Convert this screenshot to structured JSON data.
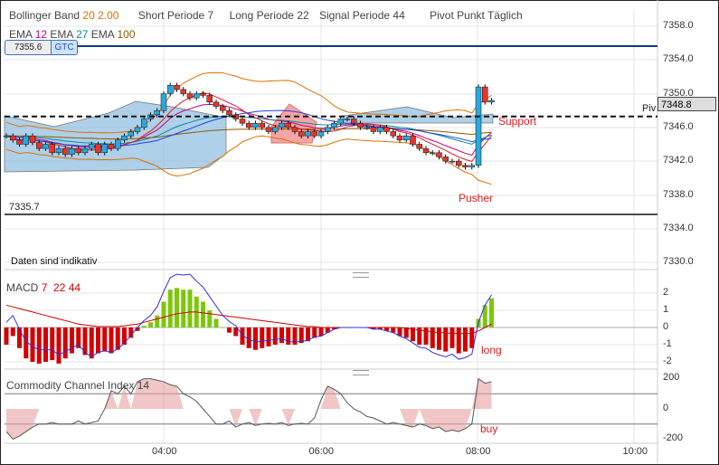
{
  "header": {
    "bollinger_label": "Bollinger Band",
    "bollinger_period": "20",
    "bollinger_dev": "2.00",
    "short_label": "Short Periode",
    "short_value": "7",
    "long_label": "Long Periode",
    "long_value": "22",
    "signal_label": "Signal Periode",
    "signal_value": "44",
    "pivot_label": "Pivot Punkt",
    "pivot_value": "Täglich",
    "ema1_label": "EMA",
    "ema1_value": "12",
    "ema2_label": "EMA",
    "ema2_value": "27",
    "ema3_label": "EMA",
    "ema3_value": "100"
  },
  "order": {
    "price": "7355.6",
    "type": "GTC"
  },
  "low_line_label": "7335.7",
  "pivot_short": "Piv",
  "current_price": "7348.8",
  "annotations": {
    "support": "Support",
    "pusher": "Pusher",
    "long": "long",
    "buy": "buy"
  },
  "disclaimer": "Daten sind indikativ",
  "macd": {
    "label": "MACD",
    "p1": "7",
    "p2": "22",
    "p3": "44",
    "axis": [
      "2",
      "1",
      "0",
      "-1",
      "-2"
    ]
  },
  "cci": {
    "label": "Commodity Channel Index",
    "period": "14",
    "axis": [
      "200",
      "0",
      "-200"
    ]
  },
  "price_axis": [
    "7358.0",
    "7354.0",
    "7350.0",
    "7346.0",
    "7342.0",
    "7338.0",
    "7334.0",
    "7330.0"
  ],
  "time_axis": [
    "04:00",
    "06:00",
    "08:00",
    "10:00"
  ],
  "colors": {
    "up": "#29a8e0",
    "down": "#e8352b",
    "macd_pos": "#7cc70a",
    "macd_neg": "#d40000"
  },
  "chart_data": {
    "type": "line",
    "bar_interval_minutes": 5,
    "start_time": "02:00",
    "price_range": [
      7330,
      7358
    ],
    "close": [
      7345,
      7344.5,
      7344,
      7345,
      7344.2,
      7343.5,
      7344,
      7343,
      7343.5,
      7342.8,
      7343.5,
      7343,
      7343.5,
      7344,
      7343,
      7344,
      7343.5,
      7344.5,
      7345,
      7345.5,
      7346,
      7347,
      7347.5,
      7348,
      7350,
      7351,
      7350.5,
      7350,
      7349.5,
      7350,
      7349.8,
      7349,
      7348.5,
      7348,
      7347.5,
      7347,
      7346.5,
      7346,
      7346.5,
      7346,
      7345.5,
      7346,
      7346.5,
      7346,
      7345.5,
      7345,
      7345.5,
      7345,
      7345.5,
      7346,
      7346.5,
      7347,
      7347,
      7346.5,
      7346,
      7346,
      7345.5,
      7346,
      7345.5,
      7345,
      7344.5,
      7345,
      7344,
      7343.5,
      7343,
      7343,
      7342.5,
      7342,
      7342,
      7341.5,
      7341.3,
      7341.5,
      7350.8,
      7349,
      7349.2
    ],
    "pivot": 7347.3,
    "macd_hist": [
      -1.0,
      -0.5,
      -1.2,
      -1.8,
      -2.0,
      -2.1,
      -2.0,
      -1.9,
      -2.1,
      -1.8,
      -1.5,
      -1.2,
      -1.6,
      -1.8,
      -1.5,
      -1.4,
      -1.5,
      -1.3,
      -1.0,
      -0.6,
      -0.2,
      0.1,
      0.3,
      0.7,
      1.5,
      2.2,
      2.3,
      2.2,
      2.2,
      1.8,
      1.5,
      1.0,
      0.5,
      0,
      -0.3,
      -0.5,
      -1.0,
      -1.2,
      -1.3,
      -1.2,
      -1.1,
      -1.0,
      -0.9,
      -1.0,
      -1.0,
      -0.9,
      -0.8,
      -0.6,
      -0.5,
      -0.3,
      -0.1,
      0,
      0,
      0,
      0,
      0,
      -0.1,
      -0.1,
      -0.2,
      -0.3,
      -0.5,
      -0.6,
      -0.8,
      -1.0,
      -1.0,
      -1.2,
      -1.3,
      -1.4,
      -1.2,
      -1.5,
      -1.4,
      -1.2,
      0.5,
      1.3,
      1.7
    ],
    "macd_signal": [
      1.3,
      1.2,
      1.1,
      1.0,
      0.9,
      0.8,
      0.7,
      0.6,
      0.5,
      0.4,
      0.3,
      0.2,
      0.15,
      0.1,
      0.05,
      0.05,
      0.05,
      0.05,
      0.1,
      0.15,
      0.2,
      0.3,
      0.4,
      0.5,
      0.6,
      0.7,
      0.8,
      0.85,
      0.9,
      0.9,
      0.85,
      0.8,
      0.75,
      0.7,
      0.65,
      0.6,
      0.55,
      0.5,
      0.45,
      0.4,
      0.35,
      0.3,
      0.25,
      0.2,
      0.15,
      0.1,
      0.05,
      0.05,
      0,
      0,
      0,
      0,
      0,
      0,
      0,
      0,
      0,
      0,
      0,
      0,
      0,
      -0.05,
      -0.1,
      -0.15,
      -0.2,
      -0.25,
      -0.3,
      -0.3,
      -0.35,
      -0.35,
      -0.35,
      -0.35,
      -0.2,
      0,
      0.2
    ],
    "cci": [
      -150,
      -200,
      -180,
      -150,
      -120,
      -100,
      -100,
      -90,
      -100,
      -100,
      -100,
      -80,
      -100,
      -90,
      -80,
      0,
      120,
      100,
      150,
      100,
      180,
      200,
      200,
      190,
      180,
      160,
      150,
      100,
      80,
      50,
      0,
      -50,
      -100,
      -100,
      -80,
      -120,
      -100,
      -90,
      -110,
      -100,
      -95,
      -100,
      -90,
      -110,
      -100,
      -95,
      -100,
      -60,
      60,
      150,
      130,
      100,
      40,
      0,
      -20,
      -50,
      -60,
      -80,
      -100,
      -90,
      -100,
      -110,
      -120,
      -100,
      -110,
      -130,
      -120,
      -150,
      -140,
      -150,
      -130,
      -100,
      200,
      170,
      180
    ],
    "cci_levels": [
      100,
      -100
    ]
  }
}
